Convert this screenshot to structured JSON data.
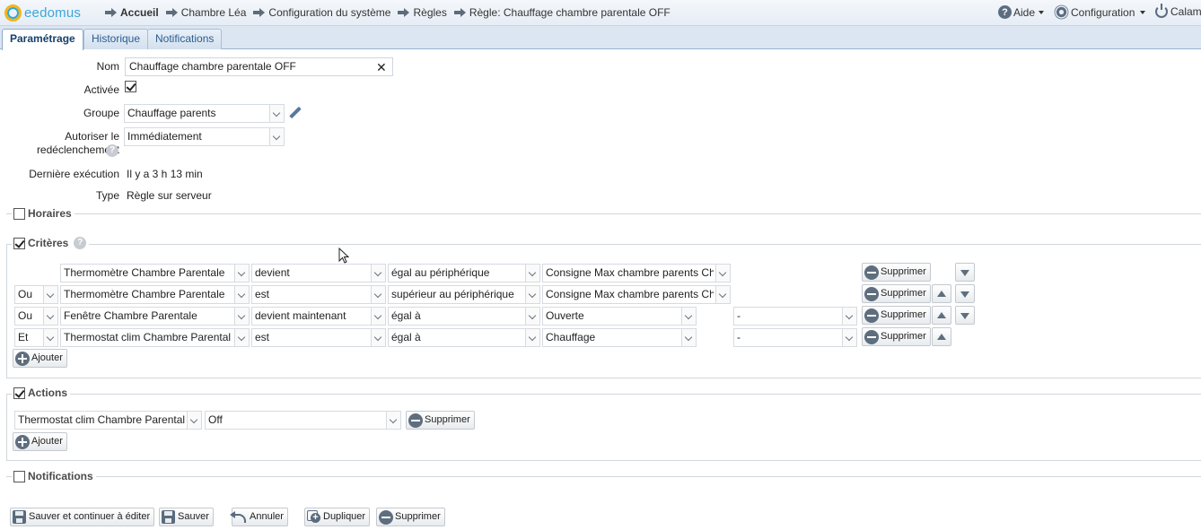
{
  "app": {
    "logo_text": "eedomus"
  },
  "breadcrumb": [
    {
      "label": "Accueil",
      "bold": true
    },
    {
      "label": "Chambre Léa"
    },
    {
      "label": "Configuration du système"
    },
    {
      "label": "Règles"
    },
    {
      "label": "Règle: Chauffage chambre parentale OFF"
    }
  ],
  "topmenu": {
    "help": "Aide",
    "config": "Configuration",
    "user": "Calame"
  },
  "tabs": [
    {
      "label": "Paramétrage",
      "active": true
    },
    {
      "label": "Historique"
    },
    {
      "label": "Notifications"
    }
  ],
  "form": {
    "name_label": "Nom",
    "name_value": "Chauffage chambre parentale OFF",
    "enabled_label": "Activée",
    "enabled": true,
    "group_label": "Groupe",
    "group_value": "Chauffage parents",
    "retrigger_label_1": "Autoriser le",
    "retrigger_label_2": "redéclenchement",
    "retrigger_value": "Immédiatement",
    "last_exec_label": "Dernière exécution",
    "last_exec_value": "Il y a 3 h 13 min",
    "type_label": "Type",
    "type_value": "Règle sur serveur"
  },
  "sections": {
    "schedules": "Horaires",
    "criteria": "Critères",
    "actions": "Actions",
    "notifications": "Notifications"
  },
  "criteria": [
    {
      "logic": "",
      "device": "Thermomètre Chambre Parentale",
      "event": "devient",
      "compare": "égal au périphérique",
      "target": "Consigne Max chambre parents Ch",
      "extra": ""
    },
    {
      "logic": "Ou",
      "device": "Thermomètre Chambre Parentale",
      "event": "est",
      "compare": "supérieur au périphérique",
      "target": "Consigne Max chambre parents Ch",
      "extra": ""
    },
    {
      "logic": "Ou",
      "device": "Fenêtre Chambre Parentale",
      "event": "devient maintenant",
      "compare": "égal à",
      "target": "Ouverte",
      "extra": "-"
    },
    {
      "logic": "Et",
      "device": "Thermostat clim Chambre Parental",
      "event": "est",
      "compare": "égal à",
      "target": "Chauffage",
      "extra": "-"
    }
  ],
  "action": {
    "device": "Thermostat clim Chambre Parental",
    "value": "Off"
  },
  "buttons": {
    "delete": "Supprimer",
    "add": "Ajouter",
    "save_continue": "Sauver et continuer à éditer",
    "save": "Sauver",
    "cancel": "Annuler",
    "duplicate": "Dupliquer",
    "delete_rule": "Supprimer"
  },
  "colors": {
    "accent": "#3aa7d6",
    "logo_yellow": "#f2b51c",
    "tab_text": "#2a5d8f"
  }
}
